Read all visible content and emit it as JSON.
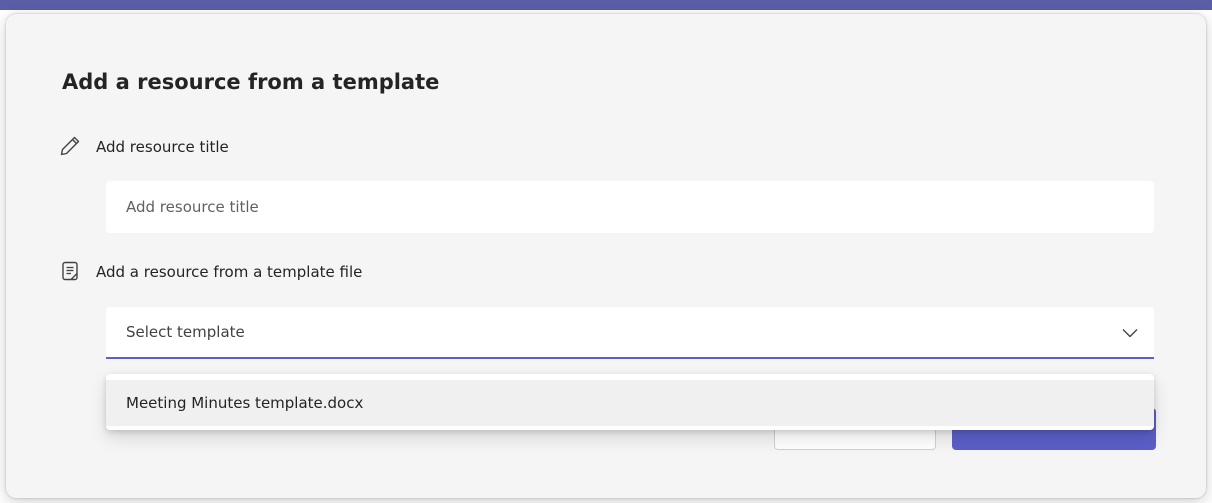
{
  "dialog": {
    "title": "Add a resource from a template",
    "title_section": {
      "icon": "pencil-icon",
      "label": "Add resource title",
      "input_placeholder": "Add resource title"
    },
    "template_section": {
      "icon": "document-icon",
      "label": "Add a resource from a template file",
      "select_value": "Select template",
      "select_icon": "chevron-down-icon",
      "options": [
        {
          "label": "Meeting Minutes template.docx"
        }
      ]
    }
  },
  "colors": {
    "accent": "#5b5fc7",
    "dialog_bg": "#f5f5f5",
    "text": "#242424"
  }
}
